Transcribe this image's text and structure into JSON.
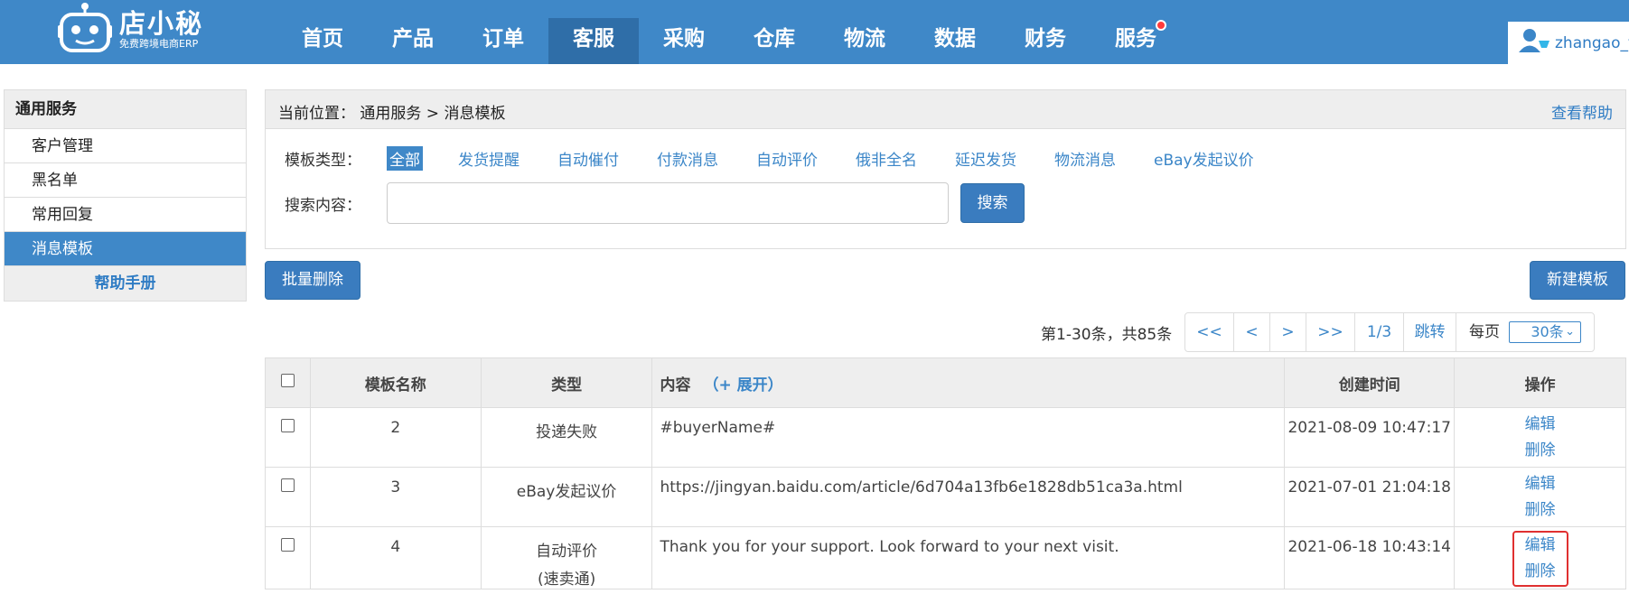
{
  "header": {
    "logo_title": "店小秘",
    "logo_subtitle": "免费跨境电商ERP",
    "nav": [
      {
        "label": "首页"
      },
      {
        "label": "产品"
      },
      {
        "label": "订单"
      },
      {
        "label": "客服"
      },
      {
        "label": "采购"
      },
      {
        "label": "仓库"
      },
      {
        "label": "物流"
      },
      {
        "label": "数据"
      },
      {
        "label": "财务"
      },
      {
        "label": "服务"
      }
    ],
    "active_nav": "客服",
    "user_name": "zhangao_t"
  },
  "sidebar": {
    "title": "通用服务",
    "items": [
      {
        "label": "客户管理"
      },
      {
        "label": "黑名单"
      },
      {
        "label": "常用回复"
      },
      {
        "label": "消息模板"
      }
    ],
    "active_item": "消息模板",
    "help_label": "帮助手册"
  },
  "breadcrumb": {
    "prefix": "当前位置：",
    "path": "通用服务 > 消息模板",
    "help_link": "查看帮助"
  },
  "filter": {
    "label": "模板类型：",
    "options": [
      {
        "label": "全部"
      },
      {
        "label": "发货提醒"
      },
      {
        "label": "自动催付"
      },
      {
        "label": "付款消息"
      },
      {
        "label": "自动评价"
      },
      {
        "label": "俄非全名"
      },
      {
        "label": "延迟发货"
      },
      {
        "label": "物流消息"
      },
      {
        "label": "eBay发起议价"
      }
    ],
    "selected": "全部"
  },
  "search": {
    "label": "搜索内容：",
    "value": "",
    "button": "搜索"
  },
  "actions": {
    "bulk_delete": "批量删除",
    "new_template": "新建模板"
  },
  "pager": {
    "info": "第1-30条，共85条",
    "first": "<<",
    "prev": "<",
    "next": ">",
    "last": ">>",
    "page": "1/3",
    "jump": "跳转",
    "per_page_label": "每页",
    "per_page_value": "30条"
  },
  "table": {
    "headers": {
      "name": "模板名称",
      "type": "类型",
      "content": "内容",
      "expand": "（+ 展开）",
      "created": "创建时间",
      "ops": "操作"
    },
    "rows": [
      {
        "name": "2",
        "type": "投递失败",
        "type2": "",
        "content": "#buyerName#",
        "created": "2021-08-09 10:47:17",
        "edit": "编辑",
        "delete": "删除"
      },
      {
        "name": "3",
        "type": "eBay发起议价",
        "type2": "",
        "content": "https://jingyan.baidu.com/article/6d704a13fb6e1828db51ca3a.html",
        "created": "2021-07-01 21:04:18",
        "edit": "编辑",
        "delete": "删除"
      },
      {
        "name": "4",
        "type": "自动评价",
        "type2": "(速卖通)",
        "content": "Thank you for your support. Look forward to your next visit.",
        "created": "2021-06-18 10:43:14",
        "edit": "编辑",
        "delete": "删除"
      }
    ]
  },
  "colors": {
    "header_bg": "#3f88c8",
    "active_nav_bg": "#2f6ea8",
    "link": "#3b86c8",
    "highlight_border": "#e03030"
  }
}
